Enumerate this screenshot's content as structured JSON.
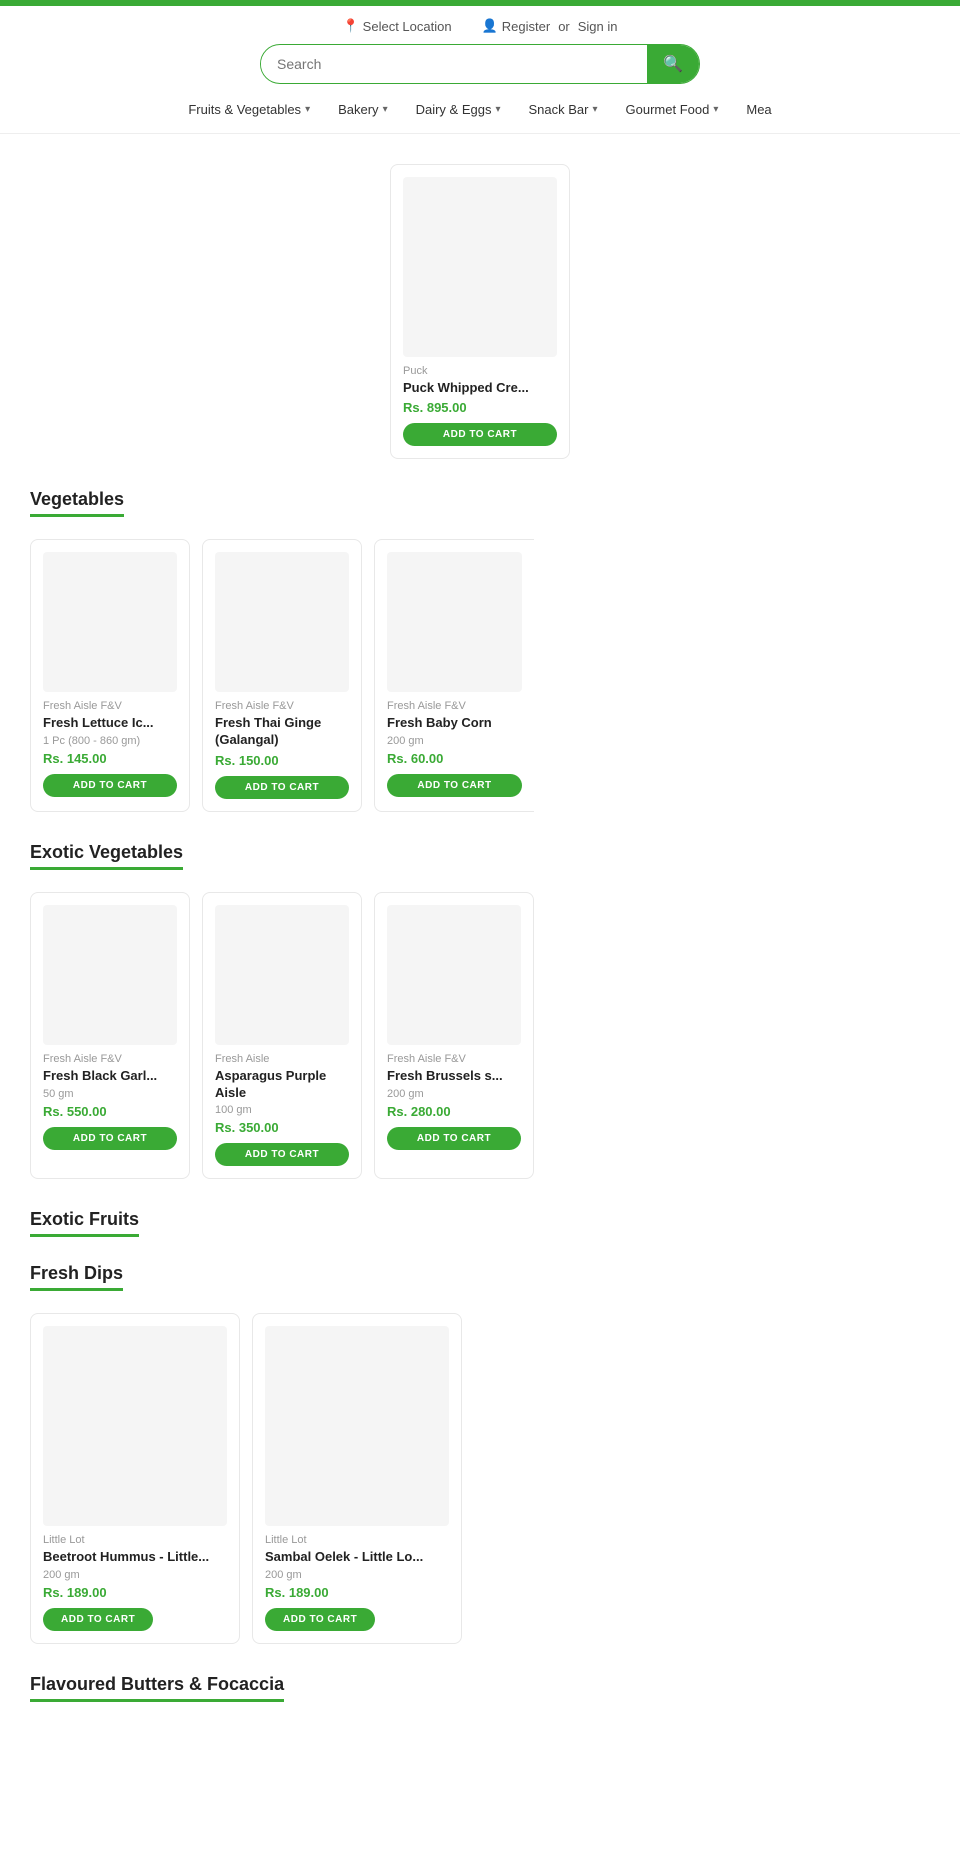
{
  "topBar": {
    "color": "#3aaa35"
  },
  "header": {
    "selectLocation": "Select Location",
    "register": "Register",
    "or": "or",
    "signIn": "Sign in",
    "searchPlaceholder": "Search"
  },
  "nav": {
    "items": [
      {
        "label": "Fruits & Vegetables",
        "hasDropdown": true
      },
      {
        "label": "Bakery",
        "hasDropdown": true
      },
      {
        "label": "Dairy & Eggs",
        "hasDropdown": true
      },
      {
        "label": "Snack Bar",
        "hasDropdown": true
      },
      {
        "label": "Gourmet Food",
        "hasDropdown": true
      },
      {
        "label": "Mea",
        "hasDropdown": false
      }
    ]
  },
  "featuredProduct": {
    "brand": "Puck",
    "name": "Puck Whipped Cre...",
    "price": "Rs. 895.00",
    "addToCart": "ADD TO CART"
  },
  "sections": [
    {
      "id": "vegetables",
      "title": "Vegetables",
      "products": [
        {
          "brand": "Fresh Aisle F&V",
          "name": "Fresh Lettuce Ic...",
          "weight": "1 Pc (800 - 860 gm)",
          "price": "Rs. 145.00",
          "addToCart": "ADD TO CART"
        },
        {
          "brand": "Fresh Aisle F&V",
          "name": "Fresh Thai Ginge (Galangal)",
          "weight": "",
          "price": "Rs. 150.00",
          "addToCart": "ADD TO CART"
        },
        {
          "brand": "Fresh Aisle F&V",
          "name": "Fresh Baby Corn",
          "weight": "200 gm",
          "price": "Rs. 60.00",
          "addToCart": "ADD TO CART"
        }
      ]
    },
    {
      "id": "exotic-vegetables",
      "title": "Exotic Vegetables",
      "products": [
        {
          "brand": "Fresh Aisle F&V",
          "name": "Fresh Black Garl...",
          "weight": "50 gm",
          "price": "Rs. 550.00",
          "addToCart": "ADD TO CART"
        },
        {
          "brand": "Fresh Aisle",
          "name": "Asparagus Purple Aisle",
          "weight": "100 gm",
          "price": "Rs. 350.00",
          "addToCart": "ADD TO CART"
        },
        {
          "brand": "Fresh Aisle F&V",
          "name": "Fresh Brussels s...",
          "weight": "200 gm",
          "price": "Rs. 280.00",
          "addToCart": "ADD TO CART"
        }
      ]
    },
    {
      "id": "exotic-fruits",
      "title": "Exotic Fruits",
      "products": []
    },
    {
      "id": "fresh-dips",
      "title": "Fresh Dips",
      "products": [
        {
          "brand": "Little Lot",
          "name": "Beetroot Hummus - Little...",
          "weight": "200 gm",
          "price": "Rs. 189.00",
          "addToCart": "ADD TO CART"
        },
        {
          "brand": "Little Lot",
          "name": "Sambal Oelek - Little Lo...",
          "weight": "200 gm",
          "price": "Rs. 189.00",
          "addToCart": "ADD TO CART"
        }
      ]
    },
    {
      "id": "flavoured-butters",
      "title": "Flavoured Butters & Focaccia",
      "products": []
    }
  ],
  "colors": {
    "green": "#3aaa35",
    "priceGreen": "#3aaa35",
    "border": "#e8e8e8",
    "textDark": "#222",
    "textMid": "#555",
    "textLight": "#999"
  }
}
